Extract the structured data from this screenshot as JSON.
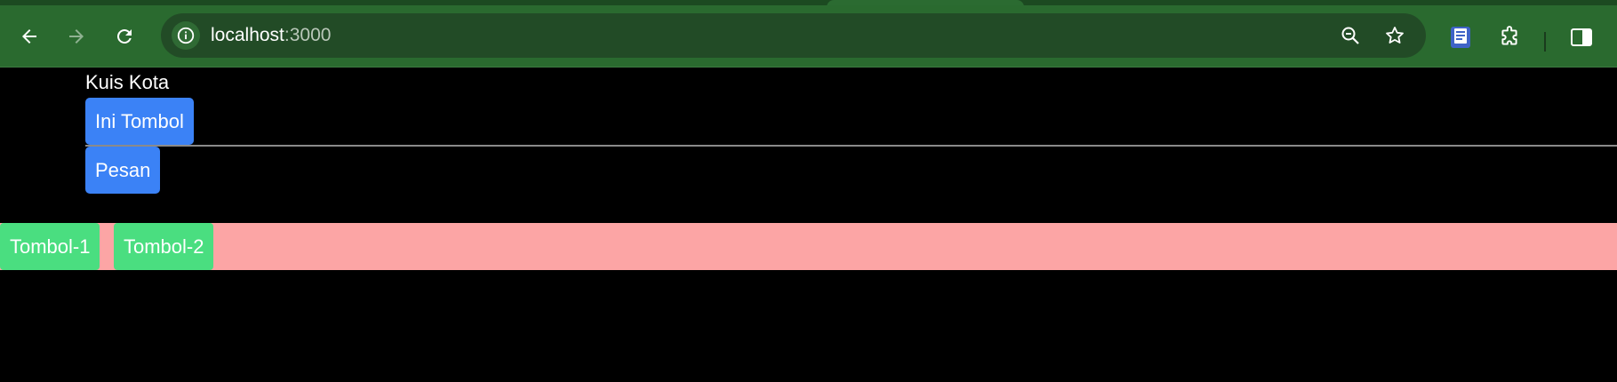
{
  "browser": {
    "url_host": "localhost",
    "url_port": ":3000",
    "icons": {
      "back": "arrow-left-icon",
      "forward": "arrow-right-icon",
      "reload": "reload-icon",
      "site_info": "info-icon",
      "zoom": "zoom-out-icon",
      "bookmark": "star-icon",
      "extension_book": "book-extension-icon",
      "extensions": "puzzle-icon",
      "side_panel": "side-panel-icon"
    },
    "colors": {
      "frame": "#1f4f24",
      "toolbar": "#2a6a2f",
      "omnibox": "#224b26"
    }
  },
  "page": {
    "title": "Kuis Kota",
    "main_button_label": "Ini Tombol",
    "message_button_label": "Pesan",
    "bar": {
      "button_1_label": "Tombol-1",
      "button_2_label": "Tombol-2"
    },
    "colors": {
      "background": "#000000",
      "blue_button": "#3b82f6",
      "pink_bar": "#fca5a5",
      "green_button": "#4ade80"
    }
  }
}
